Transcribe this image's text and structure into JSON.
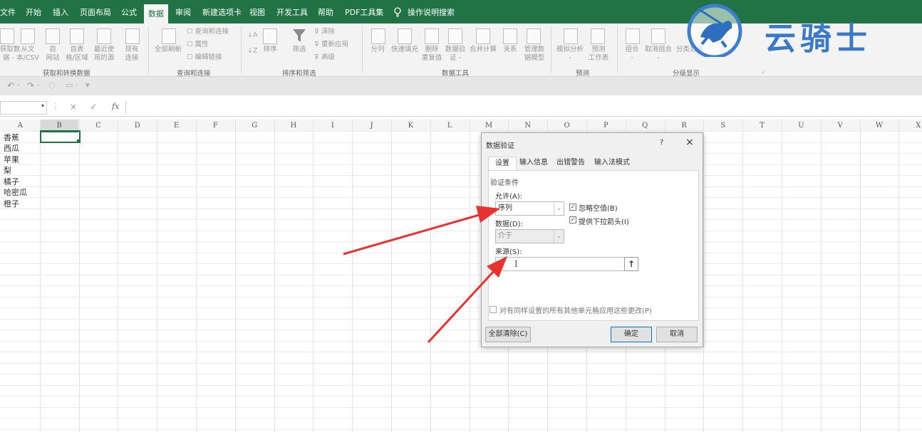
{
  "ribbon_tabs": [
    "文件",
    "开始",
    "插入",
    "页面布局",
    "公式",
    "数据",
    "审阅",
    "新建选项卡",
    "视图",
    "开发工具",
    "帮助",
    "PDF工具集"
  ],
  "active_tab": "数据",
  "tell_me": "操作说明搜索",
  "ribbon": {
    "get_transform": {
      "buttons": [
        {
          "line1": "获取数",
          "line2": "据 -"
        },
        {
          "line1": "从文",
          "line2": "本/CSV"
        },
        {
          "line1": "自",
          "line2": "网站"
        },
        {
          "line1": "自表",
          "line2": "格/区域"
        },
        {
          "line1": "最近使",
          "line2": "用的源"
        },
        {
          "line1": "现有",
          "line2": "连接"
        }
      ],
      "group_label": "获取和转换数据"
    },
    "queries": {
      "refresh_all": "全部刷新",
      "items": [
        "查询和连接",
        "属性",
        "编辑链接"
      ],
      "group_label": "查询和连接"
    },
    "sort_filter": {
      "sort": "排序",
      "filter": "筛选",
      "items": [
        "清除",
        "重新应用",
        "高级"
      ],
      "group_label": "排序和筛选"
    },
    "data_tools": {
      "buttons": [
        {
          "line1": "分列",
          "line2": ""
        },
        {
          "line1": "快速填充",
          "line2": ""
        },
        {
          "line1": "删除",
          "line2": "重复值"
        },
        {
          "line1": "数据验",
          "line2": "证 -"
        },
        {
          "line1": "合并计算",
          "line2": ""
        },
        {
          "line1": "关系",
          "line2": ""
        },
        {
          "line1": "管理数",
          "line2": "据模型"
        }
      ],
      "group_label": "数据工具"
    },
    "forecast": {
      "buttons": [
        {
          "line1": "模拟分析",
          "line2": "-"
        },
        {
          "line1": "预测",
          "line2": "工作表"
        }
      ],
      "group_label": "预测"
    },
    "outline": {
      "buttons": [
        {
          "line1": "组合",
          "line2": "-"
        },
        {
          "line1": "取消组合",
          "line2": "-"
        },
        {
          "line1": "分类汇总",
          "line2": ""
        }
      ],
      "group_label": "分级显示"
    }
  },
  "watermark_text": "云骑士",
  "formula_bar": {
    "fx": "fx",
    "cancel": "×",
    "enter": "✓"
  },
  "columns": [
    "A",
    "B",
    "C",
    "D",
    "E",
    "F",
    "G",
    "H",
    "I",
    "J",
    "K",
    "L",
    "M",
    "N",
    "O",
    "P",
    "Q",
    "R",
    "S",
    "T",
    "U",
    "V",
    "W",
    "X"
  ],
  "column_a_values": [
    "香蕉",
    "西瓜",
    "苹果",
    "梨",
    "橘子",
    "哈密瓜",
    "橙子"
  ],
  "dialog": {
    "title": "数据验证",
    "help": "?",
    "close": "×",
    "tabs": [
      "设置",
      "输入信息",
      "出错警告",
      "输入法模式"
    ],
    "section": "验证条件",
    "allow_label": "允许(A):",
    "allow_value": "序列",
    "ignore_blank": "忽略空值(B)",
    "dropdown_arrow": "提供下拉箭头(I)",
    "data_label": "数据(D):",
    "data_value": "介于",
    "source_label": "来源(S):",
    "source_value": "",
    "apply_all": "对有同样设置的所有其他单元格应用这些更改(P)",
    "clear_all": "全部清除(C)",
    "ok": "确定",
    "cancel": "取消"
  }
}
